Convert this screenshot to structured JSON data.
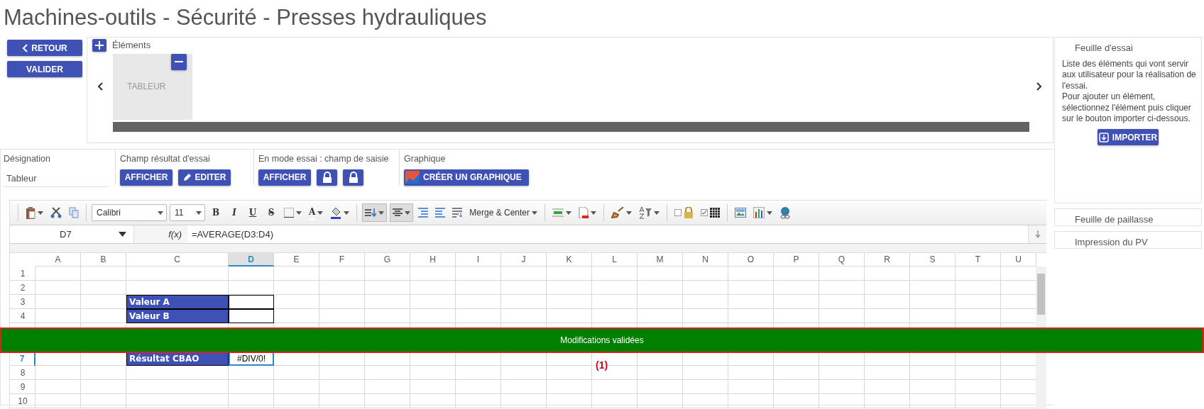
{
  "page_title": "Machines-outils - Sécurité - Presses hydrauliques",
  "nav_buttons": [
    {
      "label": "RETOUR",
      "kind": "back"
    },
    {
      "label": "VALIDER",
      "kind": "plain"
    }
  ],
  "elements": {
    "label": "Éléments",
    "items": [
      {
        "label": "TABLEUR"
      }
    ]
  },
  "side_panels": [
    {
      "title": "Feuille d'essai",
      "expanded": true,
      "paragraphs": [
        "Liste des éléments qui vont servir aux utilisateur pour la réalisation de l'essai.",
        "Pour ajouter un élément, sélectionnez l'élément puis cliquer sur le bouton importer ci-dessous."
      ],
      "button": "IMPORTER"
    },
    {
      "title": "Feuille de paillasse",
      "expanded": false
    },
    {
      "title": "Impression du PV",
      "expanded": false
    }
  ],
  "fields": [
    {
      "label": "Désignation",
      "value": "Tableur"
    },
    {
      "label": "Champ résultat d'essai",
      "buttons": [
        {
          "kind": "text",
          "label": "AFFICHER"
        },
        {
          "kind": "edit",
          "label": "EDITER"
        }
      ]
    },
    {
      "label": "En mode essai : champ de saisie",
      "buttons": [
        {
          "kind": "text",
          "label": "AFFICHER"
        },
        {
          "kind": "lock"
        },
        {
          "kind": "lock"
        }
      ]
    },
    {
      "label": "Graphique",
      "buttons": [
        {
          "kind": "chart",
          "label": "CRÉER UN GRAPHIQUE"
        }
      ]
    }
  ],
  "spreadsheet": {
    "toolbar": {
      "font": "Calibri",
      "font_size": "11",
      "style_buttons": [
        "B",
        "I",
        "U",
        "S"
      ],
      "text_color_letter": "A",
      "merge": "Merge & Center"
    },
    "name_box": "D7",
    "function_label": "f(x)",
    "formula": "=AVERAGE(D3:D4)",
    "columns": [
      {
        "label": "A",
        "selected": false
      },
      {
        "label": "B",
        "selected": false
      },
      {
        "label": "C",
        "selected": false
      },
      {
        "label": "D",
        "selected": true
      },
      {
        "label": "E",
        "selected": false
      },
      {
        "label": "F",
        "selected": false
      },
      {
        "label": "G",
        "selected": false
      },
      {
        "label": "H",
        "selected": false
      },
      {
        "label": "I",
        "selected": false
      },
      {
        "label": "J",
        "selected": false
      },
      {
        "label": "K",
        "selected": false
      },
      {
        "label": "L",
        "selected": false
      },
      {
        "label": "M",
        "selected": false
      },
      {
        "label": "N",
        "selected": false
      },
      {
        "label": "O",
        "selected": false
      },
      {
        "label": "P",
        "selected": false
      },
      {
        "label": "Q",
        "selected": false
      },
      {
        "label": "R",
        "selected": false
      },
      {
        "label": "S",
        "selected": false
      },
      {
        "label": "T",
        "selected": false
      },
      {
        "label": "U",
        "selected": false
      }
    ],
    "rows": [
      {
        "header": "1",
        "selected": false,
        "cells": []
      },
      {
        "header": "2",
        "selected": false,
        "cells": []
      },
      {
        "header": "3",
        "selected": false,
        "cells": [
          {
            "kind": "blank"
          },
          {
            "kind": "blank"
          },
          {
            "kind": "label",
            "text": "Valeur A"
          },
          {
            "kind": "input",
            "selected": false
          }
        ]
      },
      {
        "header": "4",
        "selected": false,
        "cells": [
          {
            "kind": "blank"
          },
          {
            "kind": "blank"
          },
          {
            "kind": "label",
            "text": "Valeur B"
          },
          {
            "kind": "input",
            "selected": false
          }
        ]
      },
      {
        "cells": []
      },
      {
        "cells": []
      },
      {
        "header": "7",
        "selected": true,
        "cells": [
          {
            "kind": "blank"
          },
          {
            "kind": "blank"
          },
          {
            "kind": "label",
            "text": "Résultat CBAO"
          },
          {
            "kind": "input",
            "text": "#DIV/0!",
            "selected": true
          }
        ]
      },
      {
        "header": "8",
        "selected": false,
        "cells": []
      },
      {
        "header": "9",
        "selected": false,
        "cells": []
      },
      {
        "header": "10",
        "selected": false,
        "cells": []
      }
    ]
  },
  "banner": {
    "kind": "success",
    "text": "Modifications validées"
  },
  "annotation": "(1)"
}
